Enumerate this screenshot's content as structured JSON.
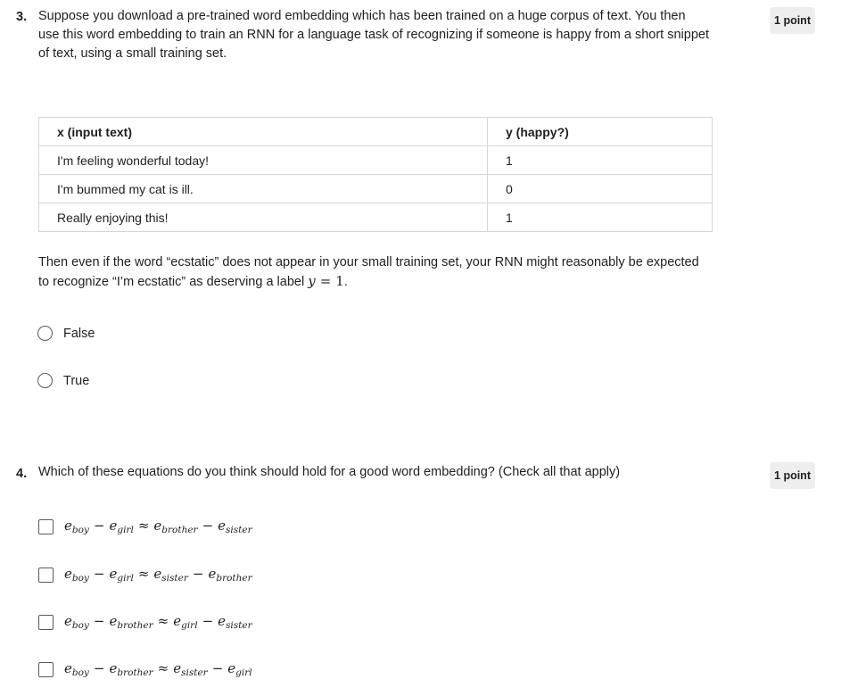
{
  "q3": {
    "number": "3.",
    "points": "1 point",
    "text": "Suppose you download a pre-trained word embedding which has been trained on a huge corpus of text. You then use this word embedding to train an RNN for a language task of recognizing if someone is happy from a short snippet of text, using a small training set.",
    "table": {
      "headers": [
        "x (input text)",
        "y (happy?)"
      ],
      "rows": [
        [
          "I'm feeling wonderful today!",
          "1"
        ],
        [
          "I'm bummed my cat is ill.",
          "0"
        ],
        [
          "Really enjoying this!",
          "1"
        ]
      ]
    },
    "followup_prefix": "Then even if the word “ecstatic” does not appear in your small training set, your RNN might reasonably be expected to recognize “I’m ecstatic” as deserving a label ",
    "followup_math_var": "y",
    "followup_math_op": "=",
    "followup_math_val": "1",
    "followup_suffix": ".",
    "options": [
      "False",
      "True"
    ]
  },
  "q4": {
    "number": "4.",
    "points": "1 point",
    "text": "Which of these equations do you think should hold for a good word embedding? (Check all that apply)",
    "options": [
      {
        "a": "boy",
        "b": "girl",
        "c": "brother",
        "d": "sister"
      },
      {
        "a": "boy",
        "b": "girl",
        "c": "sister",
        "d": "brother"
      },
      {
        "a": "boy",
        "b": "brother",
        "c": "girl",
        "d": "sister"
      },
      {
        "a": "boy",
        "b": "brother",
        "c": "sister",
        "d": "girl"
      }
    ],
    "symbols": {
      "e": "e",
      "minus": "−",
      "approx": "≈"
    }
  }
}
